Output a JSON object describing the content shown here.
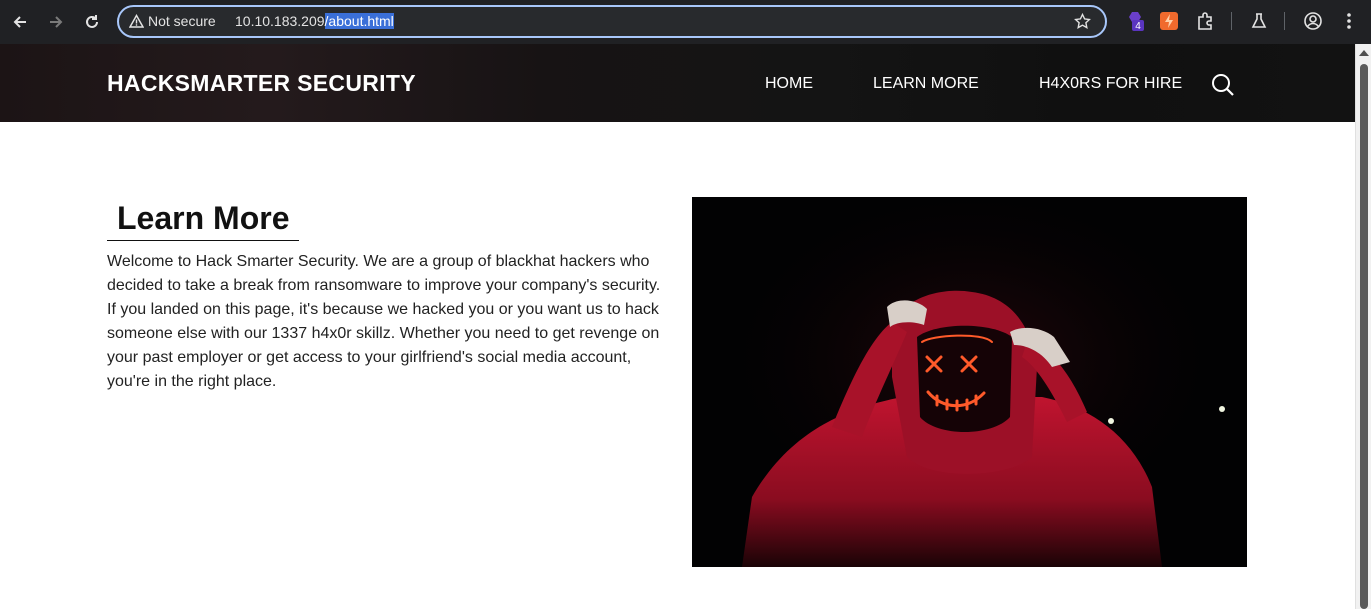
{
  "browser": {
    "security_label": "Not secure",
    "url_host": "10.10.183.209",
    "url_path": "/about.html",
    "extension_badge": "4"
  },
  "site": {
    "logo": "HACKSMARTER SECURITY",
    "nav": [
      "HOME",
      "LEARN MORE",
      "H4X0RS FOR HIRE"
    ]
  },
  "content": {
    "title": "Learn More",
    "paragraph": "Welcome to Hack Smarter Security. We are a group of blackhat hackers who decided to take a break from ransomware to improve your company's security. If you landed on this page, it's because we hacked you or you want us to hack someone else with our 1337 h4x0r skillz. Whether you need to get revenge on your past employer or get access to your girlfriend's social media account, you're in the right place."
  },
  "colors": {
    "accent": "#a8c7fa",
    "url_highlight": "#3a6fd8",
    "hoodie": "#b0122b",
    "mask_glow": "#ff5a2a"
  },
  "icons": [
    "back-icon",
    "forward-icon",
    "reload-icon",
    "warning-icon",
    "star-icon",
    "extension-icon",
    "labs-icon",
    "profile-icon",
    "menu-icon",
    "search-icon"
  ]
}
